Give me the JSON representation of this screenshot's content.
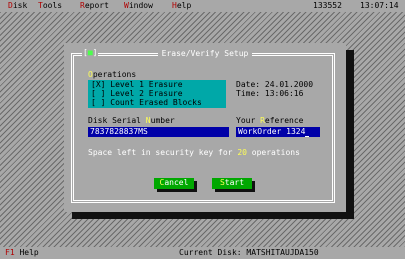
{
  "menubar": {
    "items": [
      {
        "hotkey": "D",
        "rest": "isk"
      },
      {
        "hotkey": "T",
        "rest": "ools"
      },
      {
        "hotkey": "R",
        "rest": "eport"
      },
      {
        "hotkey": "W",
        "rest": "indow"
      },
      {
        "hotkey": "H",
        "rest": "elp"
      }
    ],
    "counter": "133552",
    "clock": "13:07:14"
  },
  "dialog": {
    "close_box": "■",
    "title": "Erase/Verify Setup",
    "operations_label": {
      "hotkey": "O",
      "rest": "perations"
    },
    "options": [
      "[X] Level 1 Erasure",
      "[ ] Level 2 Erasure",
      "[ ] Count Erased Blocks"
    ],
    "date": "Date: 24.01.2000",
    "time": "Time: 13:06:16",
    "serial_label": {
      "before": "Disk Serial ",
      "hotkey": "N",
      "after": "umber"
    },
    "serial_value": "7837828837MS",
    "ref_label": {
      "before": "Your ",
      "hotkey": "R",
      "after": "eference"
    },
    "ref_value": "WorkOrder 1324",
    "message": {
      "before": "Space left in security key for ",
      "count": "20",
      "after": " operations"
    },
    "buttons": {
      "cancel": {
        "hotkey": "C",
        "rest": "ancel"
      },
      "start": {
        "hotkey": "S",
        "rest": "tart"
      }
    }
  },
  "status": {
    "help_key": "F1",
    "help_label": "Help",
    "current_disk": "Current Disk: MATSHITAUJDA150"
  },
  "colors": {
    "desktop": "#a8a8a8",
    "option_box": "#00a8a8",
    "field": "#0000a8",
    "button": "#00a800",
    "hotkey_dialog": "#ffff55",
    "hotkey_menu": "#b00000"
  }
}
